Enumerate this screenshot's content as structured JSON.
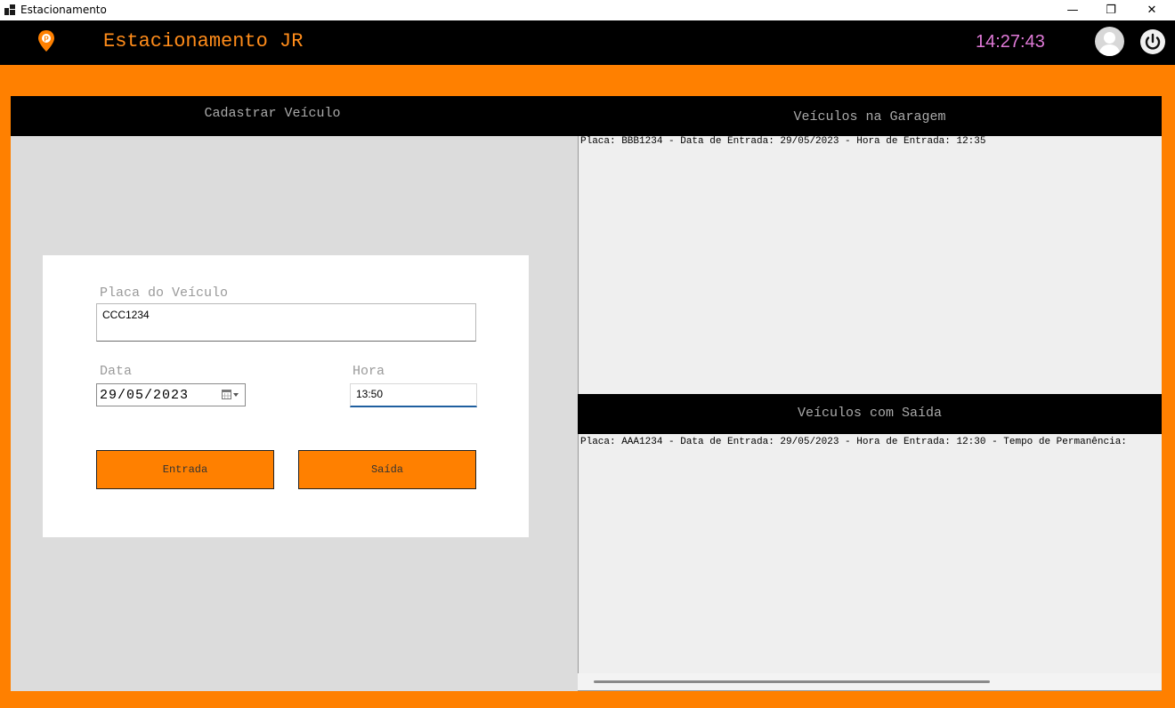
{
  "window": {
    "title": "Estacionamento",
    "controls": {
      "minimize": "—",
      "maximize": "❐",
      "close": "✕"
    }
  },
  "header": {
    "brand": "Estacionamento JR",
    "clock": "14:27:43",
    "logo_icon": "parking-pin-icon",
    "user_icon": "avatar-icon",
    "power_icon": "power-icon"
  },
  "cadastro": {
    "heading": "Cadastrar Veículo",
    "placa_label": "Placa do Veículo",
    "placa_value": "CCC1234",
    "data_label": "Data",
    "data_value": "29/05/2023",
    "hora_label": "Hora",
    "hora_value": "13:50",
    "entrada_button": "Entrada",
    "saida_button": "Saída"
  },
  "garagem": {
    "heading": "Veículos na Garagem",
    "items": [
      "Placa: BBB1234 - Data de Entrada: 29/05/2023 - Hora de Entrada: 12:35"
    ]
  },
  "saidas": {
    "heading": "Veículos com Saída",
    "items": [
      "Placa: AAA1234 - Data de Entrada: 29/05/2023 - Hora de Entrada: 12:30 - Tempo de Permanência:"
    ]
  },
  "colors": {
    "accent": "#ff8000",
    "header_bg": "#000000",
    "brand_text": "#ff8c1a",
    "clock_text": "#e07ad8"
  }
}
